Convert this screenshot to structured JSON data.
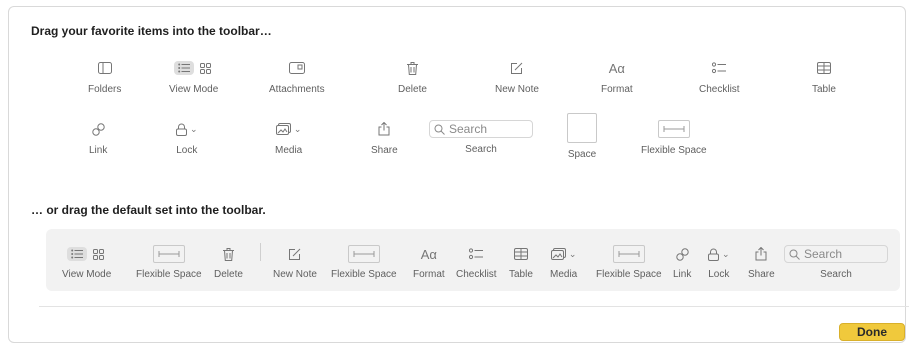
{
  "heading_top": "Drag your favorite items into the toolbar…",
  "heading_bottom": "… or drag the default set into the toolbar.",
  "palette": {
    "folders": "Folders",
    "view_mode": "View Mode",
    "attachments": "Attachments",
    "delete": "Delete",
    "new_note": "New Note",
    "format": "Format",
    "checklist": "Checklist",
    "table": "Table",
    "link": "Link",
    "lock": "Lock",
    "media": "Media",
    "share": "Share",
    "search": "Search",
    "search_placeholder": "Search",
    "space": "Space",
    "flexible_space": "Flexible Space"
  },
  "default_set": {
    "view_mode": "View Mode",
    "flexible_space_1": "Flexible Space",
    "delete": "Delete",
    "new_note": "New Note",
    "flexible_space_2": "Flexible Space",
    "format": "Format",
    "checklist": "Checklist",
    "table": "Table",
    "media": "Media",
    "flexible_space_3": "Flexible Space",
    "link": "Link",
    "lock": "Lock",
    "share": "Share",
    "search": "Search",
    "search_placeholder": "Search"
  },
  "done_button": "Done",
  "format_glyph": "Aα",
  "colors": {
    "accent_done": "#f0c93c",
    "icon": "#767676",
    "label": "#5f5f5f"
  }
}
